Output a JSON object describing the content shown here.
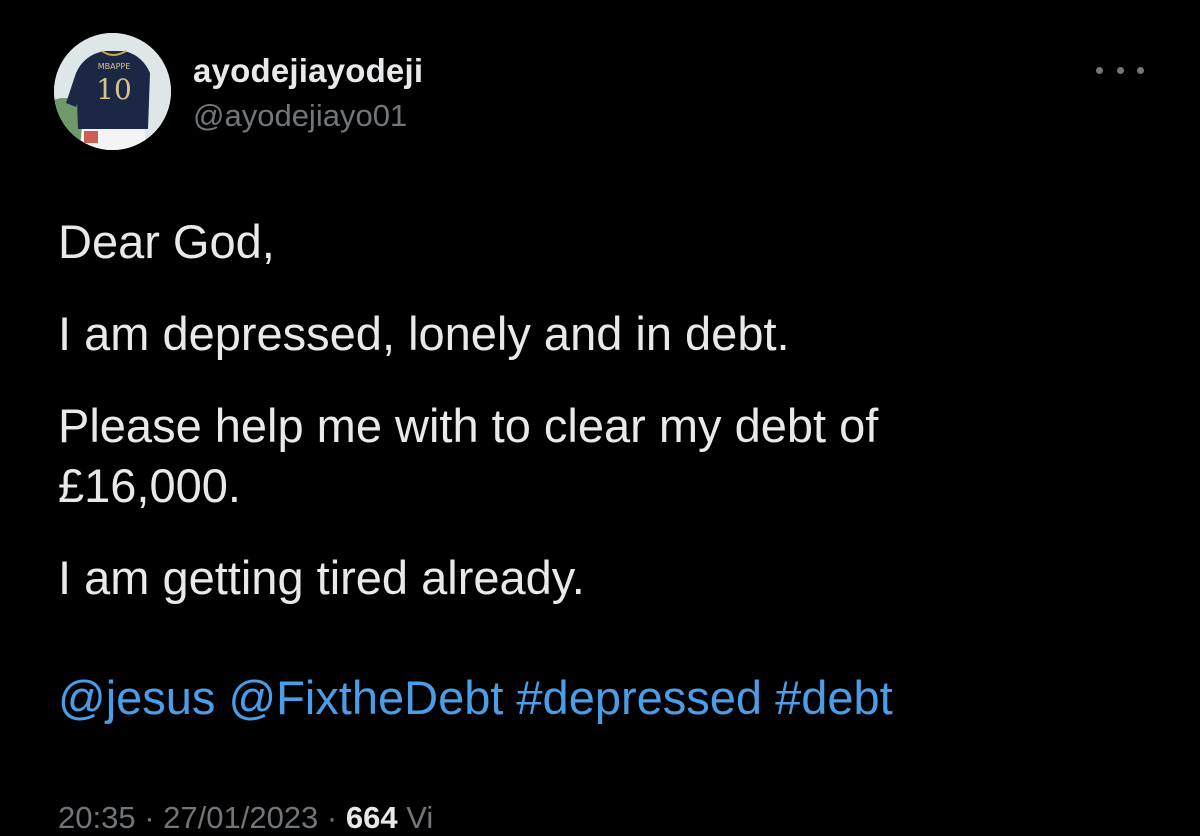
{
  "user": {
    "display_name": "ayodejiayodeji",
    "handle": "@ayodejiayo01",
    "avatar_jersey_name": "MBAPPE",
    "avatar_jersey_number": "10"
  },
  "tweet": {
    "paragraphs": [
      "Dear God,",
      "I am depressed, lonely and in debt.",
      "Please help me with to clear my debt of\n£16,000.",
      "I am getting tired already."
    ],
    "entities": [
      "@jesus",
      "@FixtheDebt",
      "#depressed",
      "#debt"
    ]
  },
  "meta": {
    "time": "20:35",
    "date": "27/01/2023",
    "views_count": "664",
    "views_label": "Vi"
  },
  "colors": {
    "background": "#000000",
    "text": "#e7e9ea",
    "secondary": "#71767b",
    "link": "#4a9ee8"
  },
  "icons": {
    "more": "more-horizontal-icon"
  }
}
